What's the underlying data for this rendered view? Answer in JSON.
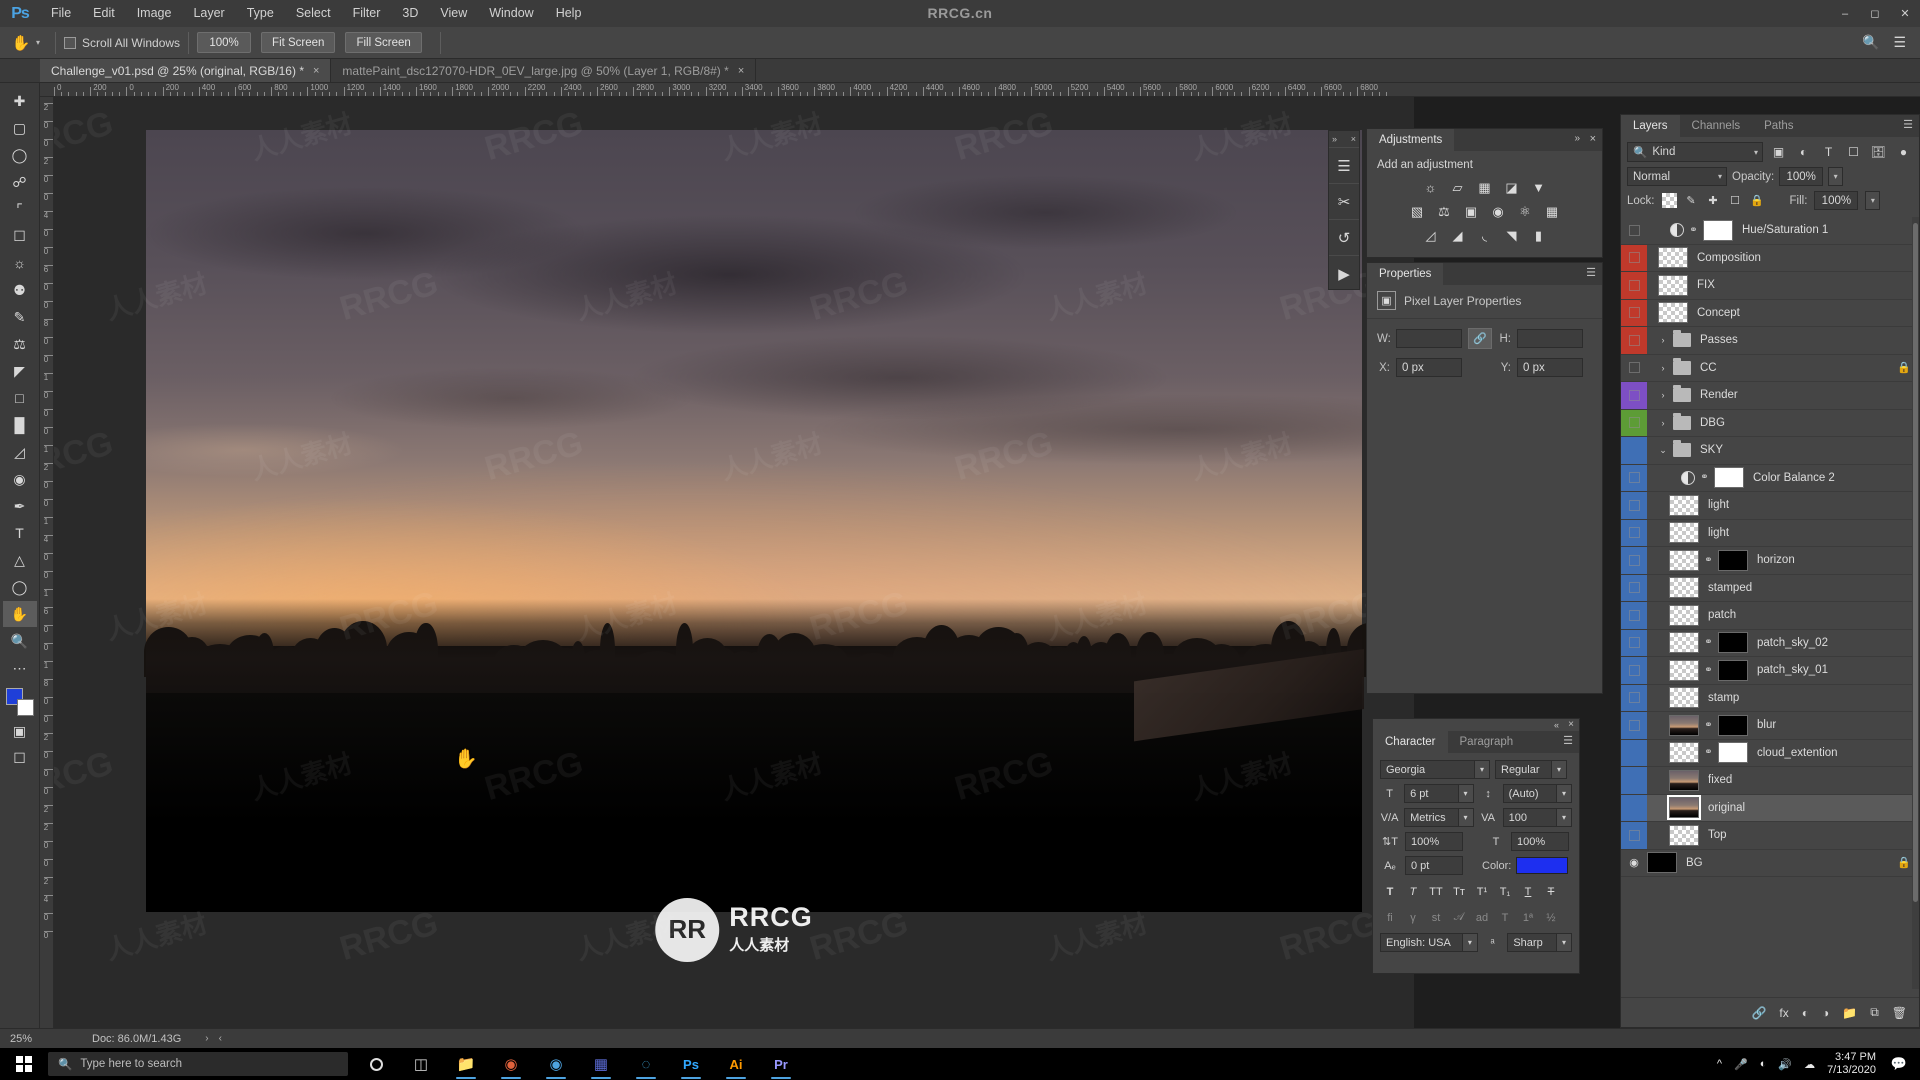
{
  "app": {
    "logo": "Ps",
    "watermark": "RRCG.cn",
    "menu": [
      "File",
      "Edit",
      "Image",
      "Layer",
      "Type",
      "Select",
      "Filter",
      "3D",
      "View",
      "Window",
      "Help"
    ],
    "window_controls": [
      "minimize",
      "restore",
      "close"
    ]
  },
  "options_bar": {
    "tool_icon": "hand-tool-icon",
    "scroll_all_windows": "Scroll All Windows",
    "buttons": [
      "100%",
      "Fit Screen",
      "Fill Screen"
    ],
    "right_icons": [
      "search-icon",
      "workspace-icon"
    ]
  },
  "tabs": [
    {
      "label": "Challenge_v01.psd @ 25% (original, RGB/16) *",
      "active": true,
      "close": "×"
    },
    {
      "label": "mattePaint_dsc127070-HDR_0EV_large.jpg @ 50% (Layer 1, RGB/8#) *",
      "active": false,
      "close": "×"
    }
  ],
  "toolbox": {
    "tools": [
      "move-tool",
      "marquee-tool",
      "lasso-tool",
      "object-select-tool",
      "crop-tool",
      "frame-tool",
      "eyedropper-tool",
      "spot-healing-tool",
      "brush-tool",
      "clone-stamp-tool",
      "history-brush-tool",
      "eraser-tool",
      "gradient-tool",
      "blur-tool",
      "dodge-tool",
      "pen-tool",
      "type-tool",
      "path-select-tool",
      "shape-tool",
      "hand-tool",
      "zoom-tool",
      "more-tools"
    ],
    "foreground_color": "#1f3fd8",
    "background_color": "#ffffff",
    "screen_mode": "screen-mode-icon",
    "quick_mask": "quick-mask-icon"
  },
  "rulers": {
    "horizontal_labels": [
      "0",
      "200",
      "0",
      "200",
      "400",
      "600",
      "800",
      "1000",
      "1200",
      "1400",
      "1600",
      "1800",
      "2000",
      "2200",
      "2400",
      "2600",
      "2800",
      "3000",
      "3200",
      "3400",
      "3600",
      "3800",
      "4000",
      "4200",
      "4400",
      "4600",
      "4800",
      "5000",
      "5200",
      "5400",
      "5600",
      "5800",
      "6000",
      "6200",
      "6400",
      "6600",
      "6800"
    ],
    "vertical_labels": [
      "2",
      "0",
      "0",
      "2",
      "0",
      "0",
      "4",
      "0",
      "0",
      "6",
      "0",
      "0",
      "8",
      "0",
      "0",
      "1",
      "0",
      "0",
      "0",
      "1",
      "2",
      "0",
      "0",
      "1",
      "4",
      "0",
      "0",
      "1",
      "6",
      "0",
      "0",
      "1",
      "8",
      "0",
      "0",
      "2",
      "0",
      "0",
      "0",
      "2",
      "2",
      "0",
      "0",
      "2",
      "4",
      "0",
      "0"
    ]
  },
  "icon_dock": {
    "collapse": "»",
    "close": "×",
    "items": [
      "adjustments-dock-icon",
      "brushes-dock-icon",
      "actions-dock-icon",
      "play-dock-icon"
    ]
  },
  "adjustments_panel": {
    "tab": "Adjustments",
    "collapse": "»",
    "close": "×",
    "title": "Add an adjustment",
    "icons_row1": [
      "brightness-contrast-icon",
      "levels-icon",
      "curves-icon",
      "exposure-icon",
      "vibrance-icon"
    ],
    "icons_row2": [
      "hue-saturation-icon",
      "color-balance-icon",
      "black-white-icon",
      "photo-filter-icon",
      "channel-mixer-icon",
      "color-lookup-icon"
    ],
    "icons_row3": [
      "invert-icon",
      "posterize-icon",
      "threshold-icon",
      "selective-color-icon",
      "gradient-map-icon"
    ]
  },
  "properties_panel": {
    "tab": "Properties",
    "header_icon": "pixel-layer-icon",
    "header": "Pixel Layer Properties",
    "w_label": "W:",
    "w_value": "",
    "h_label": "H:",
    "h_value": "",
    "link_icon": "link-dimensions-icon",
    "x_label": "X:",
    "x_value": "0 px",
    "y_label": "Y:",
    "y_value": "0 px"
  },
  "character_panel": {
    "tabs": [
      "Character",
      "Paragraph"
    ],
    "active_tab": "Character",
    "collapse": "«",
    "close": "×",
    "font_family": "Georgia",
    "font_style": "Regular",
    "size_icon": "font-size-icon",
    "font_size": "6 pt",
    "leading_icon": "leading-icon",
    "leading": "(Auto)",
    "kerning_icon": "kerning-icon",
    "kerning": "Metrics",
    "tracking_icon": "tracking-icon",
    "tracking": "100",
    "vscale_icon": "vertical-scale-icon",
    "vertical_scale": "100%",
    "hscale_icon": "horizontal-scale-icon",
    "horizontal_scale": "100%",
    "baseline_icon": "baseline-shift-icon",
    "baseline_shift": "0 pt",
    "color_label": "Color:",
    "color_value": "#1d2ff0",
    "style_row1": [
      "bold-icon",
      "italic-icon",
      "all-caps-icon",
      "small-caps-icon",
      "superscript-icon",
      "subscript-icon",
      "underline-icon",
      "strikethrough-icon"
    ],
    "style_row2": [
      "standard-ligatures-icon",
      "contextual-alternates-icon",
      "discretionary-ligatures-icon",
      "swash-icon",
      "titling-alternates-icon",
      "ordinals-icon",
      "stylistic-alternates-icon",
      "fractions-icon"
    ],
    "language": "English: USA",
    "aa_icon": "anti-aliasing-icon",
    "anti_alias": "Sharp"
  },
  "layers_panel": {
    "tabs": [
      "Layers",
      "Channels",
      "Paths"
    ],
    "active_tab": "Layers",
    "menu_icon": "panel-menu-icon",
    "filter_label": "Kind",
    "filter_icon": "search-icon",
    "filter_type_icons": [
      "pixel-filter-icon",
      "adjustment-filter-icon",
      "type-filter-icon",
      "shape-filter-icon",
      "smart-object-filter-icon",
      "filter-toggle-icon"
    ],
    "blend_mode": "Normal",
    "opacity_label": "Opacity:",
    "opacity_value": "100%",
    "lock_label": "Lock:",
    "lock_icons": [
      "lock-transparent-icon",
      "lock-image-icon",
      "lock-position-icon",
      "lock-artboard-icon",
      "lock-all-icon"
    ],
    "fill_label": "Fill:",
    "fill_value": "100%",
    "layers": [
      {
        "name": "Hue/Saturation 1",
        "visible": false,
        "type": "adjustment",
        "mask": "white",
        "indent": 1,
        "color": "none",
        "selected": false,
        "locked": false
      },
      {
        "name": "Composition",
        "visible": false,
        "type": "pixel",
        "indent": 1,
        "color": "#c0392b",
        "selected": false,
        "locked": false
      },
      {
        "name": "FIX",
        "visible": false,
        "type": "pixel",
        "indent": 1,
        "color": "#c0392b",
        "selected": false,
        "locked": false
      },
      {
        "name": "Concept",
        "visible": false,
        "type": "pixel",
        "indent": 1,
        "color": "#c0392b",
        "selected": false,
        "locked": false
      },
      {
        "name": "Passes",
        "visible": false,
        "type": "group",
        "indent": 1,
        "color": "#c0392b",
        "selected": false,
        "locked": false,
        "expanded": false
      },
      {
        "name": "CC",
        "visible": false,
        "type": "group",
        "indent": 1,
        "color": "none",
        "selected": false,
        "locked": true,
        "expanded": false
      },
      {
        "name": "Render",
        "visible": false,
        "type": "group",
        "indent": 1,
        "color": "#7d4fc4",
        "selected": false,
        "locked": false,
        "expanded": false
      },
      {
        "name": "DBG",
        "visible": false,
        "type": "group",
        "indent": 1,
        "color": "#5d9c36",
        "selected": false,
        "locked": false,
        "expanded": false
      },
      {
        "name": "SKY",
        "visible": true,
        "type": "group",
        "indent": 1,
        "color": "#3f6fb5",
        "selected": false,
        "locked": false,
        "expanded": true
      },
      {
        "name": "Color Balance 2",
        "visible": false,
        "type": "adjustment",
        "mask": "white",
        "indent": 2,
        "color": "#3f6fb5",
        "selected": false,
        "locked": false
      },
      {
        "name": "light",
        "visible": false,
        "type": "pixel",
        "indent": 2,
        "color": "#3f6fb5",
        "selected": false,
        "locked": false
      },
      {
        "name": "light",
        "visible": false,
        "type": "pixel",
        "indent": 2,
        "color": "#3f6fb5",
        "selected": false,
        "locked": false
      },
      {
        "name": "horizon",
        "visible": false,
        "type": "pixel",
        "mask": "black",
        "indent": 2,
        "color": "#3f6fb5",
        "selected": false,
        "locked": false
      },
      {
        "name": "stamped",
        "visible": false,
        "type": "pixel",
        "indent": 2,
        "color": "#3f6fb5",
        "selected": false,
        "locked": false
      },
      {
        "name": "patch",
        "visible": false,
        "type": "pixel",
        "indent": 2,
        "color": "#3f6fb5",
        "selected": false,
        "locked": false
      },
      {
        "name": "patch_sky_02",
        "visible": false,
        "type": "pixel",
        "mask": "black",
        "indent": 2,
        "color": "#3f6fb5",
        "selected": false,
        "locked": false
      },
      {
        "name": "patch_sky_01",
        "visible": false,
        "type": "pixel",
        "mask": "black",
        "indent": 2,
        "color": "#3f6fb5",
        "selected": false,
        "locked": false
      },
      {
        "name": "stamp",
        "visible": false,
        "type": "pixel",
        "indent": 2,
        "color": "#3f6fb5",
        "selected": false,
        "locked": false
      },
      {
        "name": "blur",
        "visible": false,
        "type": "photo",
        "mask": "black",
        "indent": 2,
        "color": "#3f6fb5",
        "selected": false,
        "locked": false
      },
      {
        "name": "cloud_extention",
        "visible": true,
        "type": "pixel",
        "mask": "white",
        "indent": 2,
        "color": "#3f6fb5",
        "selected": false,
        "locked": false
      },
      {
        "name": "fixed",
        "visible": true,
        "type": "photo",
        "indent": 2,
        "color": "#3f6fb5",
        "selected": false,
        "locked": false
      },
      {
        "name": "original",
        "visible": true,
        "type": "photo",
        "indent": 2,
        "color": "#3f6fb5",
        "selected": true,
        "locked": false
      },
      {
        "name": "Top",
        "visible": false,
        "type": "pixel",
        "indent": 2,
        "color": "#3f6fb5",
        "selected": false,
        "locked": false
      },
      {
        "name": "BG",
        "visible": true,
        "type": "solid-black",
        "indent": 0,
        "color": "none",
        "selected": false,
        "locked": true
      }
    ],
    "bottom_icons": [
      "link-layers-icon",
      "layer-style-icon",
      "layer-mask-icon",
      "adjustment-layer-icon",
      "new-group-icon",
      "new-layer-icon",
      "delete-layer-icon"
    ]
  },
  "canvas": {
    "cursor_icon": "hand-cursor-icon",
    "watermark_badge": "RR",
    "watermark_big": "RRCG",
    "watermark_small": "人人素材",
    "tile_watermark": "RRCG",
    "tile_watermark_cn": "人人素材"
  },
  "status_bar": {
    "zoom": "25%",
    "doc_info": "Doc: 86.0M/1.43G",
    "arrow_right": "›",
    "arrow_left": "‹"
  },
  "taskbar": {
    "start_icon": "windows-start-icon",
    "search_icon": "search-icon",
    "search_placeholder": "Type here to search",
    "apps": [
      {
        "icon": "cortana-icon",
        "running": false
      },
      {
        "icon": "task-view-icon",
        "running": false
      },
      {
        "icon": "file-explorer-icon",
        "running": true
      },
      {
        "icon": "media-player-icon",
        "running": true
      },
      {
        "icon": "chrome-icon",
        "running": true
      },
      {
        "icon": "teams-icon",
        "running": true
      },
      {
        "icon": "edge-icon",
        "running": true
      },
      {
        "icon": "photoshop-icon",
        "running": true,
        "label": "Ps"
      },
      {
        "icon": "illustrator-icon",
        "running": true,
        "label": "Ai"
      },
      {
        "icon": "premiere-icon",
        "running": true,
        "label": "Pr"
      }
    ],
    "tray_icons": [
      "show-hidden-icon",
      "microphone-icon",
      "wifi-icon",
      "volume-icon",
      "onedrive-icon"
    ],
    "time": "3:47 PM",
    "date": "7/13/2020",
    "notification_icon": "notification-icon"
  }
}
